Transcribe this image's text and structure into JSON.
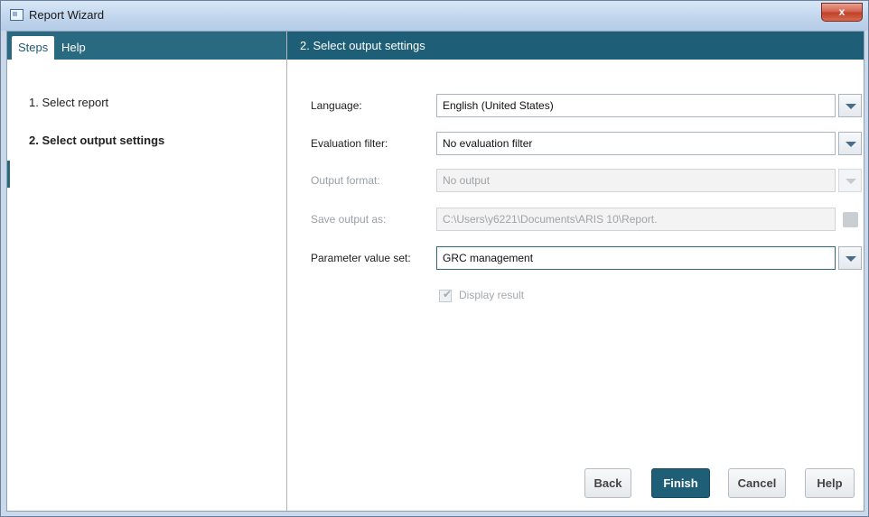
{
  "window": {
    "title": "Report Wizard",
    "close_glyph": "x"
  },
  "left_panel": {
    "tabs": [
      {
        "label": "Steps"
      },
      {
        "label": "Help"
      }
    ],
    "steps": [
      {
        "label": "1. Select report"
      },
      {
        "label": "2. Select output settings"
      }
    ]
  },
  "right_panel": {
    "header": "2. Select output settings",
    "language": {
      "label": "Language:",
      "value": "English (United States)"
    },
    "evaluation_filter": {
      "label": "Evaluation filter:",
      "value": "No evaluation filter"
    },
    "output_format": {
      "label": "Output format:",
      "value": "No output"
    },
    "save_output": {
      "label": "Save output as:",
      "value": "C:\\Users\\y6221\\Documents\\ARIS 10\\Report."
    },
    "parameter_value_set": {
      "label": "Parameter value set:",
      "value": "GRC management"
    },
    "display_result": {
      "label": "Display result",
      "checked": true
    }
  },
  "buttons": {
    "back": "Back",
    "finish": "Finish",
    "cancel": "Cancel",
    "help": "Help"
  },
  "colors": {
    "accent": "#1e5f77",
    "tab_header": "#2a6a80"
  }
}
